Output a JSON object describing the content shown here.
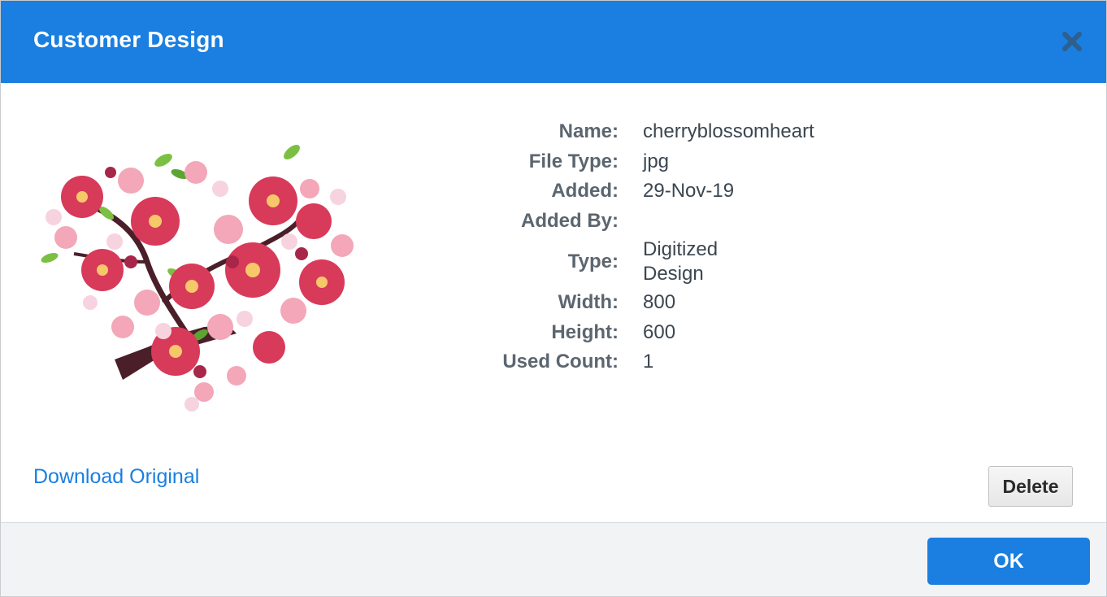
{
  "dialog": {
    "title": "Customer Design",
    "close_icon": "close-icon",
    "accent_color": "#1a7fe0"
  },
  "preview": {
    "icon": "cherry-blossom-heart-image"
  },
  "details": {
    "rows": [
      {
        "label": "Name:",
        "value": "cherryblossomheart"
      },
      {
        "label": "File Type:",
        "value": "jpg"
      },
      {
        "label": "Added:",
        "value": "29-Nov-19"
      },
      {
        "label": "Added By:",
        "value": ""
      },
      {
        "label": "Type:",
        "value": "Digitized Design"
      },
      {
        "label": "Width:",
        "value": "800"
      },
      {
        "label": "Height:",
        "value": "600"
      },
      {
        "label": "Used Count:",
        "value": "1"
      }
    ]
  },
  "actions": {
    "download_label": "Download Original",
    "delete_label": "Delete",
    "ok_label": "OK"
  }
}
